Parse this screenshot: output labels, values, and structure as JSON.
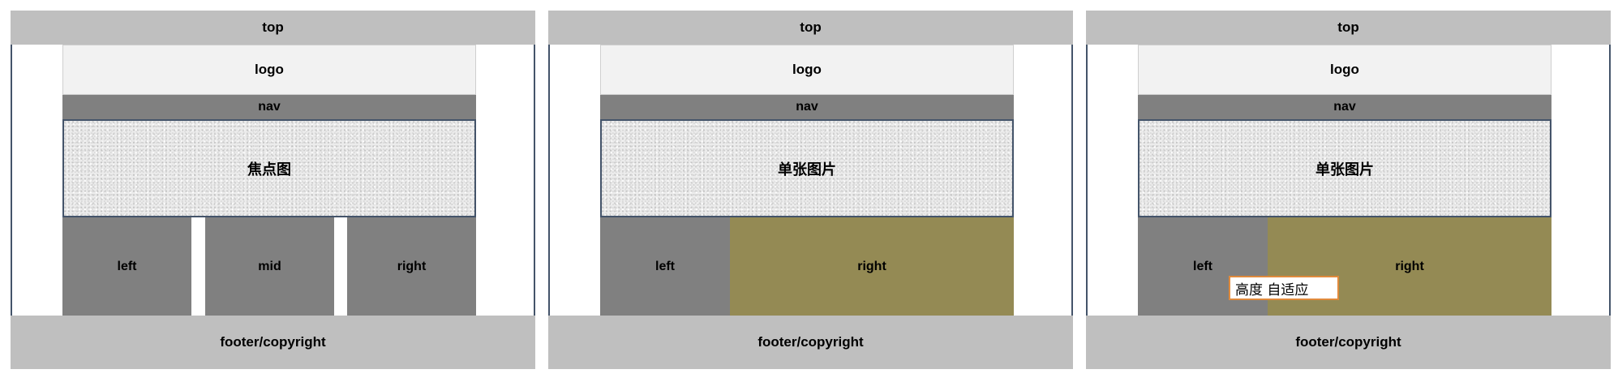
{
  "panels": [
    {
      "top": "top",
      "logo": "logo",
      "nav": "nav",
      "banner": "焦点图",
      "columns": [
        "left",
        "mid",
        "right"
      ],
      "footer": "footer/copyright"
    },
    {
      "top": "top",
      "logo": "logo",
      "nav": "nav",
      "banner": "单张图片",
      "columns": [
        "left",
        "right"
      ],
      "footer": "footer/copyright"
    },
    {
      "top": "top",
      "logo": "logo",
      "nav": "nav",
      "banner": "单张图片",
      "columns": [
        "left",
        "right"
      ],
      "footer": "footer/copyright",
      "callout": "高度 自适应"
    }
  ],
  "colors": {
    "top_footer": "#bfbfbf",
    "logo": "#f2f2f2",
    "nav": "#808080",
    "column_grey": "#808080",
    "column_olive": "#948a54",
    "frame": "#44546a",
    "callout_border": "#e08a3c"
  }
}
